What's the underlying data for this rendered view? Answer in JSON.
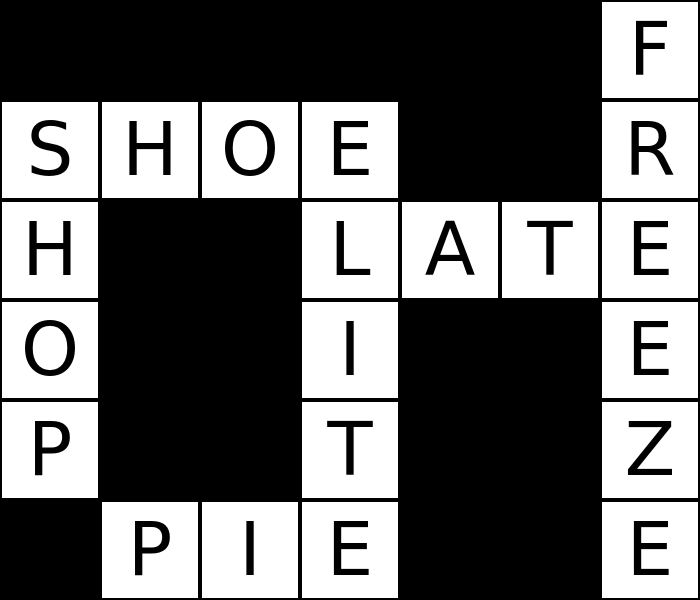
{
  "puzzle": {
    "rows": 6,
    "cols": 7,
    "colors": {
      "block": "#000000",
      "cell": "#ffffff",
      "letter": "#000000"
    },
    "grid": [
      [
        "#",
        "#",
        "#",
        "#",
        "#",
        "#",
        "F"
      ],
      [
        "S",
        "H",
        "O",
        "E",
        "#",
        "#",
        "R"
      ],
      [
        "H",
        "#",
        "#",
        "L",
        "A",
        "T",
        "E"
      ],
      [
        "O",
        "#",
        "#",
        "I",
        "#",
        "#",
        "E"
      ],
      [
        "P",
        "#",
        "#",
        "T",
        "#",
        "#",
        "Z"
      ],
      [
        "#",
        "P",
        "I",
        "E",
        "#",
        "#",
        "E"
      ]
    ]
  }
}
